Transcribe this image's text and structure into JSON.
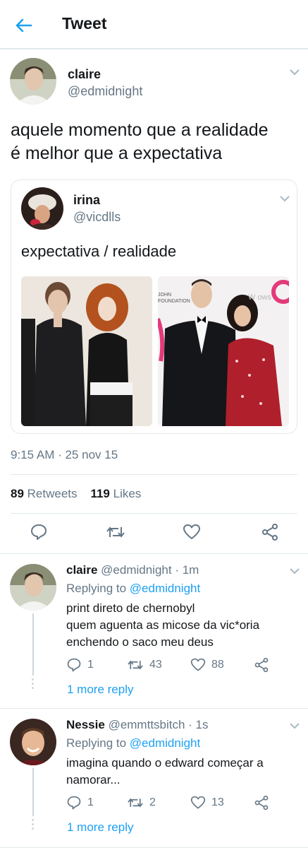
{
  "header": {
    "title": "Tweet"
  },
  "tweet": {
    "name": "claire",
    "handle": "@edmidnight",
    "text_line1": "aquele momento que a realidade",
    "text_line2": "é melhor que a expectativa",
    "quote": {
      "name": "irina",
      "handle": "@vicdlls",
      "text": "expectativa / realidade",
      "photo_right_caption_1": "JOHN",
      "photo_right_caption_2": "FOUNDATION",
      "photo_right_caption_3": "W  ows"
    },
    "timestamp": "9:15 AM · 25 nov 15",
    "retweets_count": "89",
    "retweets_label": "Retweets",
    "likes_count": "119",
    "likes_label": "Likes"
  },
  "replies": [
    {
      "name": "claire",
      "meta": "@edmidnight · 1m",
      "replying_prefix": "Replying to",
      "replying_handle": "@edmidnight",
      "line1": "print direto de chernobyl",
      "line2": "quem aguenta as micose da vic*oria",
      "line3": "enchendo o saco meu deus",
      "reply_count": "1",
      "retweet_count": "43",
      "like_count": "88",
      "more": "1 more reply"
    },
    {
      "name": "Nessie",
      "meta": "@emmttsbitch · 1s",
      "replying_prefix": "Replying to",
      "replying_handle": "@edmidnight",
      "line1": "imagina quando o edward começar a",
      "line2": "namorar...",
      "reply_count": "1",
      "retweet_count": "2",
      "like_count": "13",
      "more": "1 more reply"
    }
  ],
  "colors": {
    "accent": "#1da1f2",
    "secondary_text": "#657786",
    "border": "#e1e8ed"
  }
}
